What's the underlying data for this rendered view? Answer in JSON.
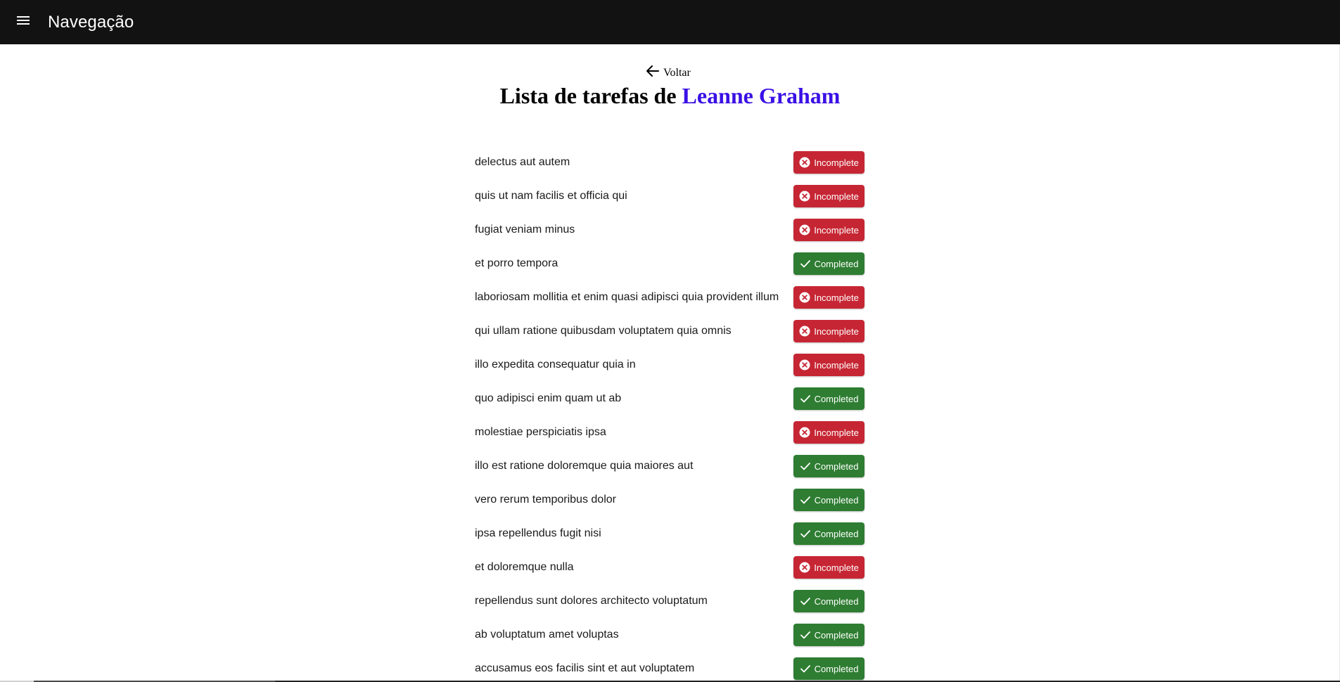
{
  "appbar": {
    "title": "Navegação",
    "menu_icon": "menu-icon",
    "background": "#121212"
  },
  "back": {
    "label": "Voltar",
    "icon": "arrow-left-icon"
  },
  "heading": {
    "prefix": "Lista de tarefas de",
    "name": "Leanne Graham",
    "name_color": "#3a10e5"
  },
  "status_labels": {
    "incomplete": "Incomplete",
    "completed": "Completed"
  },
  "status_colors": {
    "incomplete": "#c62633",
    "completed": "#2e7d32"
  },
  "todos": [
    {
      "title": "delectus aut autem",
      "completed": false
    },
    {
      "title": "quis ut nam facilis et officia qui",
      "completed": false
    },
    {
      "title": "fugiat veniam minus",
      "completed": false
    },
    {
      "title": "et porro tempora",
      "completed": true
    },
    {
      "title": "laboriosam mollitia et enim quasi adipisci quia provident illum",
      "completed": false
    },
    {
      "title": "qui ullam ratione quibusdam voluptatem quia omnis",
      "completed": false
    },
    {
      "title": "illo expedita consequatur quia in",
      "completed": false
    },
    {
      "title": "quo adipisci enim quam ut ab",
      "completed": true
    },
    {
      "title": "molestiae perspiciatis ipsa",
      "completed": false
    },
    {
      "title": "illo est ratione doloremque quia maiores aut",
      "completed": true
    },
    {
      "title": "vero rerum temporibus dolor",
      "completed": true
    },
    {
      "title": "ipsa repellendus fugit nisi",
      "completed": true
    },
    {
      "title": "et doloremque nulla",
      "completed": false
    },
    {
      "title": "repellendus sunt dolores architecto voluptatum",
      "completed": true
    },
    {
      "title": "ab voluptatum amet voluptas",
      "completed": true
    },
    {
      "title": "accusamus eos facilis sint et aut voluptatem",
      "completed": true
    }
  ]
}
